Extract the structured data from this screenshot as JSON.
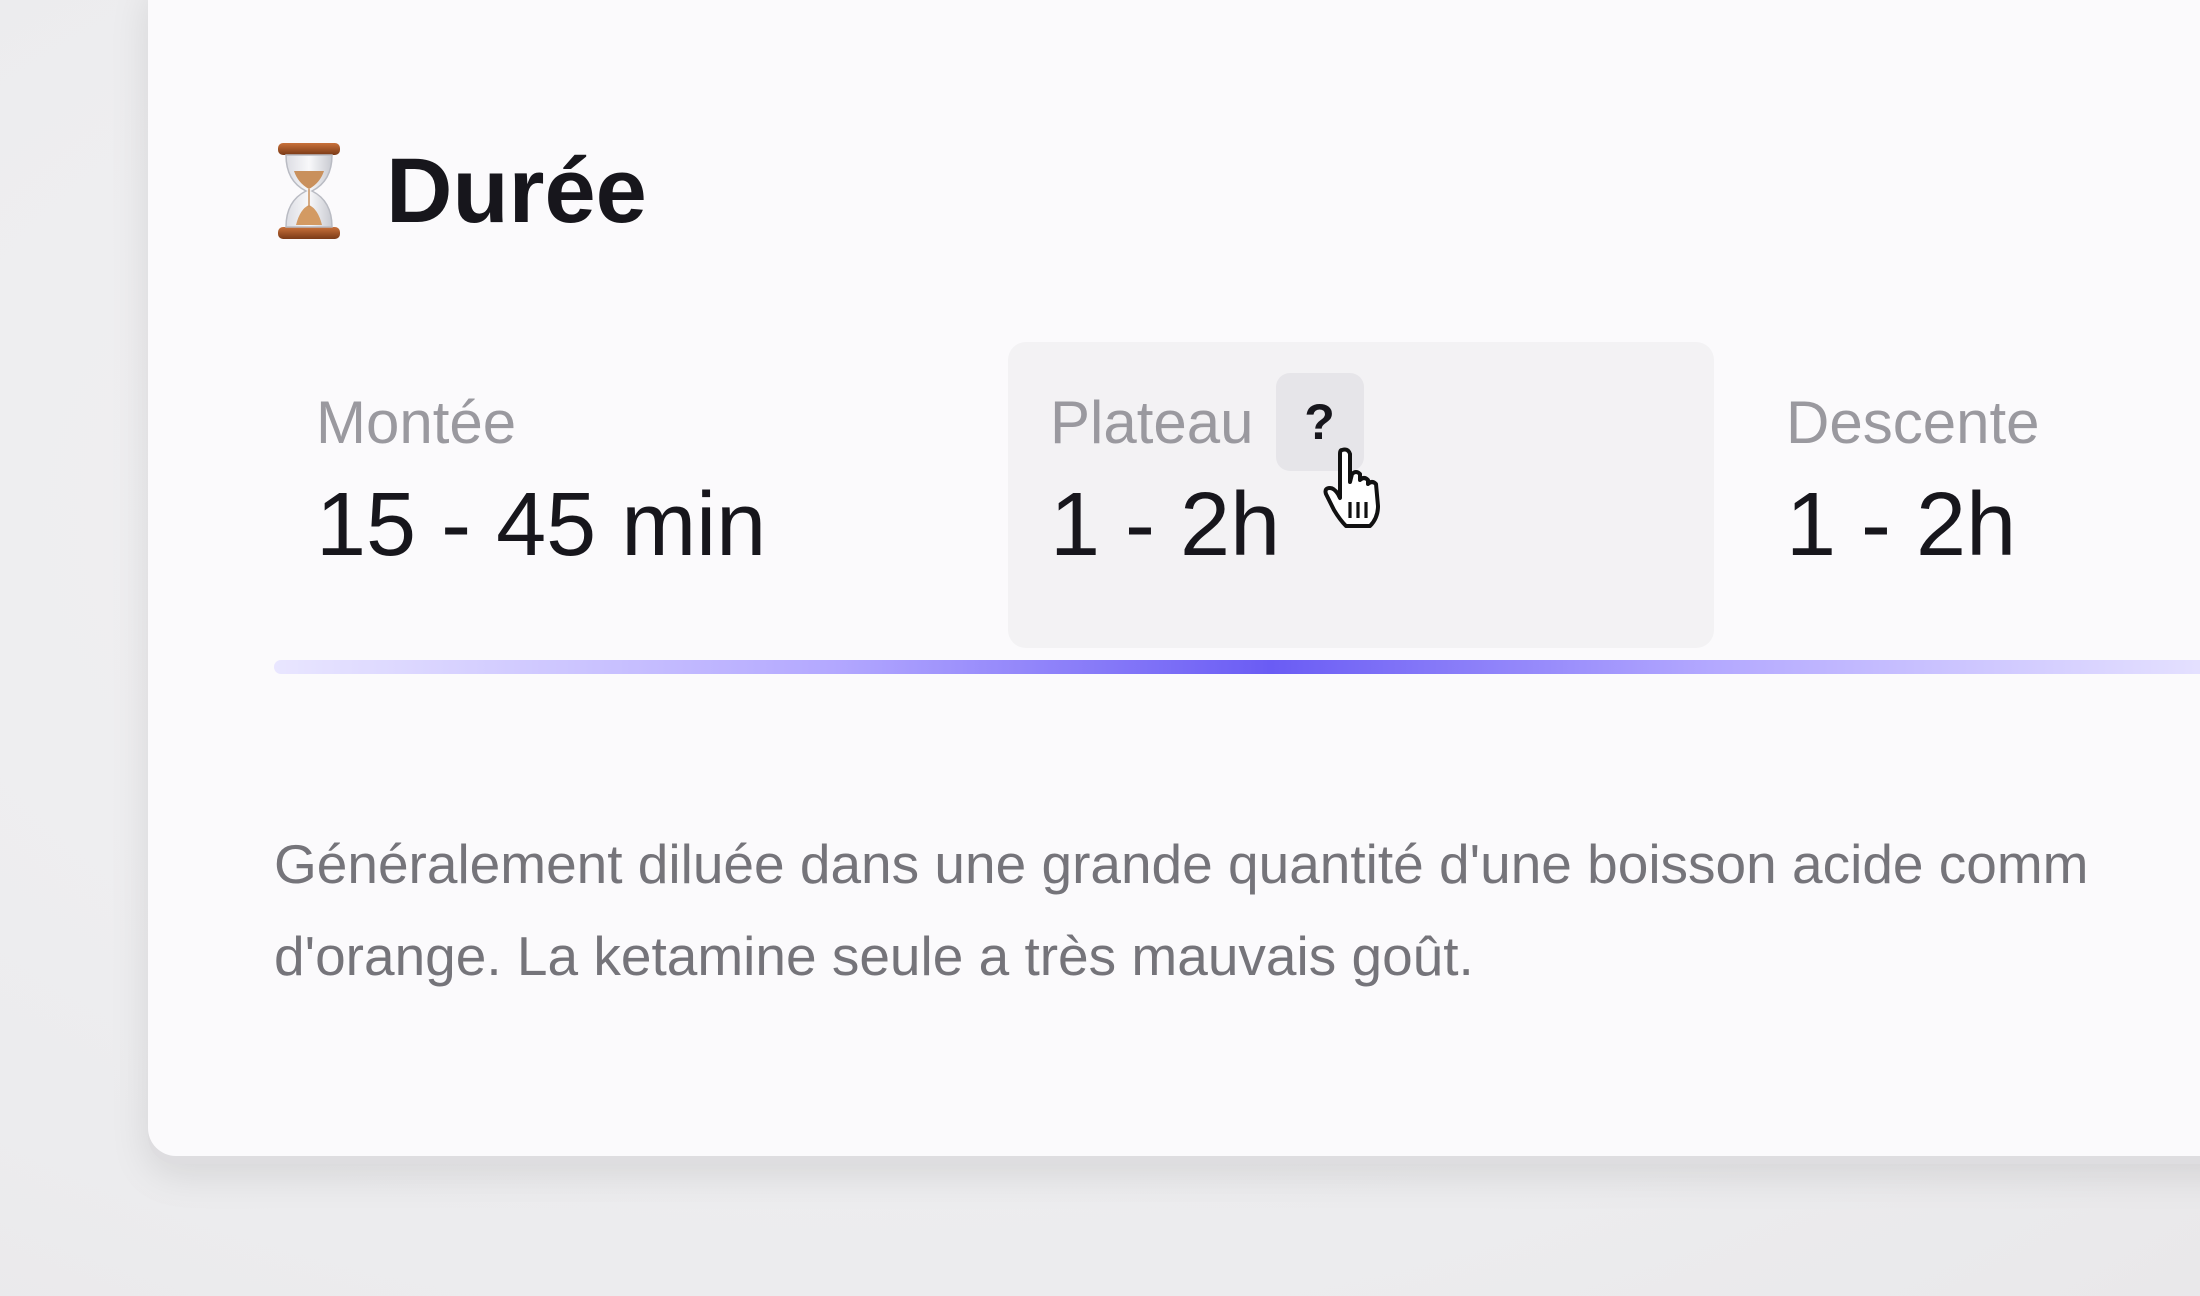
{
  "section": {
    "icon": "hourglass-icon",
    "title": "Durée"
  },
  "phases": [
    {
      "label": "Montée",
      "value": "15 - 45 min"
    },
    {
      "label": "Plateau",
      "value": "1 - 2h",
      "help": "?"
    },
    {
      "label": "Descente",
      "value": "1 - 2h"
    }
  ],
  "timeline": {
    "colors": [
      "#e9e6ff",
      "#6a5cf4",
      "#ebe8ff"
    ]
  },
  "description": {
    "line1": "Généralement diluée dans une grande quantité d'une boisson acide comm",
    "line2": "d'orange. La ketamine seule a très mauvais goût."
  },
  "colors": {
    "accent": "#6a5cf4",
    "text": "#17161c",
    "muted": "#9a999f"
  }
}
